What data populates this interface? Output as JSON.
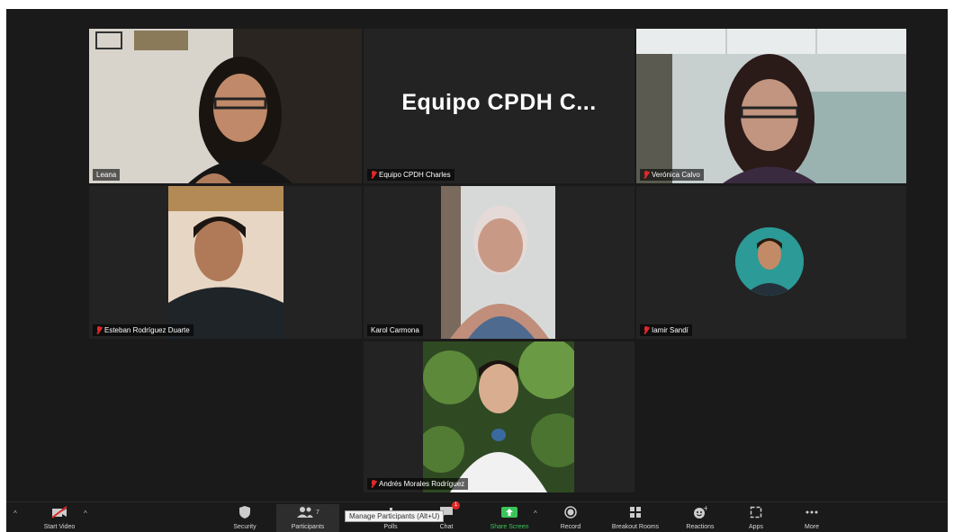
{
  "participants": [
    {
      "name": "Leana",
      "muted": false,
      "active_speaker": true
    },
    {
      "name": "Equipo CPDH Charles",
      "display_title": "Equipo CPDH C...",
      "muted": true
    },
    {
      "name": "Verónica Calvo",
      "muted": true
    },
    {
      "name": "Esteban Rodríguez Duarte",
      "muted": true
    },
    {
      "name": "Karol Carmona",
      "muted": false
    },
    {
      "name": "Iamir Sandí",
      "muted": true
    },
    {
      "name": "Andrés Morales Rodríguez",
      "muted": true
    }
  ],
  "toolbar": {
    "start_video": "Start Video",
    "security": "Security",
    "participants": "Participants",
    "participants_count": "7",
    "polls": "Polls",
    "chat": "Chat",
    "chat_badge": "1",
    "share_screen": "Share Screen",
    "record": "Record",
    "breakout_rooms": "Breakout Rooms",
    "reactions": "Reactions",
    "apps": "Apps",
    "more": "More"
  },
  "tooltip": "Manage Participants (Alt+U)",
  "colors": {
    "active_border": "#c9e05a",
    "muted_icon": "#e02828",
    "share_screen": "#3bc45a",
    "background": "#1a1a1a"
  }
}
